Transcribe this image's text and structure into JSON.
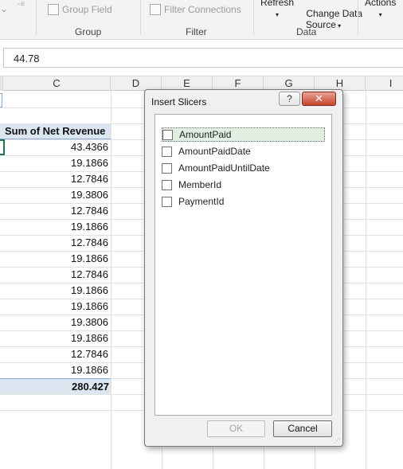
{
  "ribbon": {
    "group_field_label": "Group Field",
    "group_label": "Group",
    "filter_connections_label": "Filter Connections",
    "filter_label": "Filter",
    "refresh_label": "Refresh",
    "change_data_source_label": "Change Data\nSource",
    "data_label": "Data",
    "actions_label": "Actions"
  },
  "formula_bar": {
    "value": "44.78"
  },
  "columns": [
    "C",
    "D",
    "E",
    "F",
    "G",
    "H",
    "I"
  ],
  "pivot": {
    "header": "Sum of Net Revenue",
    "values": [
      "43.4366",
      "19.1866",
      "12.7846",
      "19.3806",
      "12.7846",
      "19.1866",
      "12.7846",
      "19.1866",
      "12.7846",
      "19.1866",
      "19.1866",
      "19.3806",
      "19.1866",
      "12.7846",
      "19.1866"
    ],
    "total": "280.427"
  },
  "dialog": {
    "title": "Insert Slicers",
    "help_label": "?",
    "close_label": "✕",
    "fields": [
      {
        "label": "AmountPaid",
        "checked": false,
        "selected": true
      },
      {
        "label": "AmountPaidDate",
        "checked": false,
        "selected": false
      },
      {
        "label": "AmountPaidUntilDate",
        "checked": false,
        "selected": false
      },
      {
        "label": "MemberId",
        "checked": false,
        "selected": false
      },
      {
        "label": "PaymentId",
        "checked": false,
        "selected": false
      }
    ],
    "ok_label": "OK",
    "cancel_label": "Cancel"
  }
}
